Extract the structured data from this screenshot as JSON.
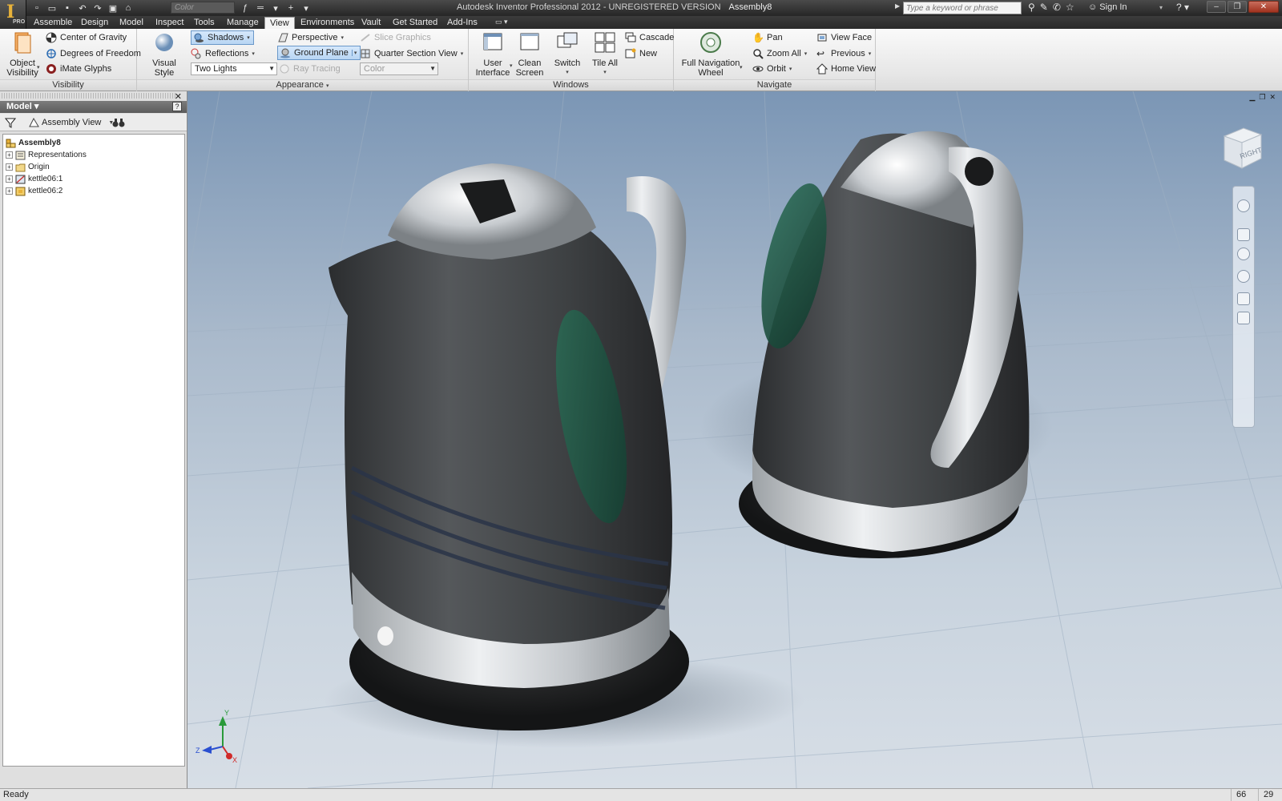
{
  "app": {
    "title": "Autodesk Inventor Professional 2012 - UNREGISTERED VERSION",
    "document": "Assembly8",
    "logo_letter": "I",
    "logo_badge": "PRO",
    "qat_color_placeholder": "Color"
  },
  "titlebar": {
    "search_placeholder": "Type a keyword or phrase",
    "sign_in": "Sign In",
    "help": "?"
  },
  "tabs": [
    "Assemble",
    "Design",
    "Model",
    "Inspect",
    "Tools",
    "Manage",
    "View",
    "Environments",
    "Vault",
    "Get Started",
    "Add-Ins"
  ],
  "active_tab": "View",
  "ribbon": {
    "visibility": {
      "title": "Visibility",
      "object_visibility": [
        "Object",
        "Visibility"
      ],
      "center_of_gravity": "Center of Gravity",
      "degrees_of_freedom": "Degrees of Freedom",
      "imate_glyphs": "iMate Glyphs"
    },
    "appearance": {
      "title": "Appearance",
      "visual_style": "Visual Style",
      "shadows": "Shadows",
      "reflections": "Reflections",
      "lighting": "Two Lights",
      "perspective": "Perspective",
      "ground_plane": "Ground Plane",
      "ray_tracing": "Ray Tracing",
      "slice_graphics": "Slice Graphics",
      "quarter_section_view": "Quarter Section View",
      "color_override": "Color"
    },
    "windows": {
      "title": "Windows",
      "user_interface": [
        "User",
        "Interface"
      ],
      "clean_screen": [
        "Clean",
        "Screen"
      ],
      "switch": "Switch",
      "tile_all": "Tile All",
      "cascade": "Cascade",
      "new": "New"
    },
    "navigate": {
      "title": "Navigate",
      "full_navigation_wheel": [
        "Full Navigation",
        "Wheel"
      ],
      "pan": "Pan",
      "zoom_all": "Zoom All",
      "orbit": "Orbit",
      "view_face": "View Face",
      "previous": "Previous",
      "home_view": "Home View"
    }
  },
  "browser": {
    "title": "Model",
    "view_mode": "Assembly View",
    "tree": [
      {
        "label": "Assembly8",
        "icon": "assembly-icon",
        "level": 0
      },
      {
        "label": "Representations",
        "icon": "representations-icon",
        "level": 1
      },
      {
        "label": "Origin",
        "icon": "folder-icon",
        "level": 1
      },
      {
        "label": "kettle06:1",
        "icon": "part-icon",
        "level": 1
      },
      {
        "label": "kettle06:2",
        "icon": "part-icon",
        "level": 1
      }
    ]
  },
  "viewport": {
    "viewcube_face": "RIGHT",
    "triad_labels": {
      "x": "X",
      "y": "Y",
      "z": "Z"
    }
  },
  "status": {
    "text": "Ready",
    "count_a": "66",
    "count_b": "29"
  },
  "colors": {
    "ribbon_active_blue": "#b8d5f3",
    "titlebar_dark": "#2f2f2f",
    "viewport_top": "#7e98b5",
    "viewport_floor": "#cdd7e1",
    "kettle_body": "#3f4143",
    "kettle_window": "#1f5a47"
  }
}
